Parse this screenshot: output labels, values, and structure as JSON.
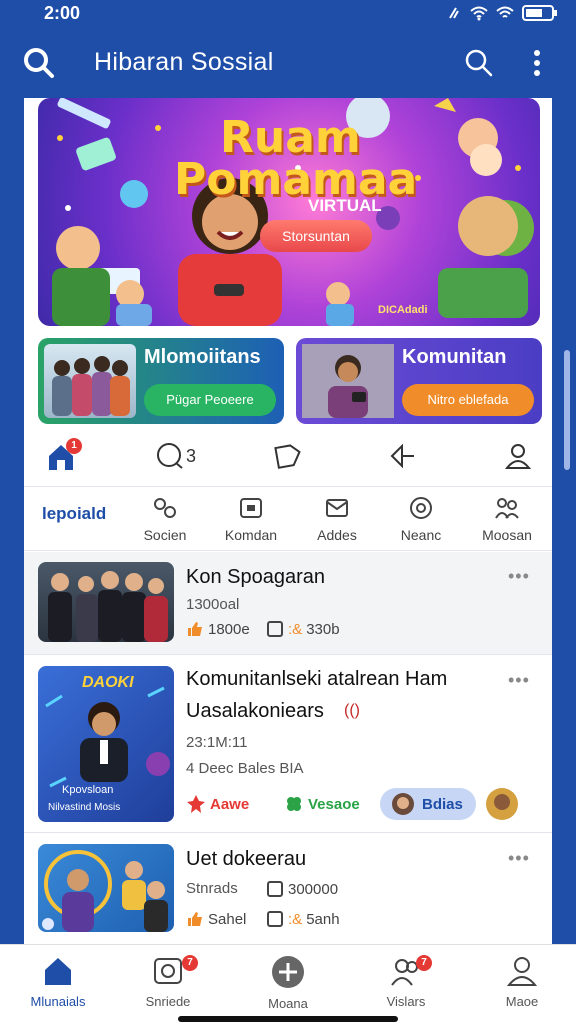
{
  "status_bar": {
    "time": "2:00"
  },
  "app_bar": {
    "title": "Hibaran Sossial"
  },
  "banner": {
    "title_line1": "Ruam",
    "title_line2": "Pomamaa",
    "subtitle": "VIRTUAL",
    "pill_label": "Storsuntan",
    "corner_text": "DICAdadi",
    "colors": {
      "title": "#ffd23a",
      "pill": "#e8484a"
    }
  },
  "community_cards": [
    {
      "title": "Mlomoiitans",
      "button": "Pügar Peoeere",
      "color": "#28b463"
    },
    {
      "title": "Komunitan",
      "button": "Nitro eblefada",
      "color": "#f08d2a"
    }
  ],
  "quick_actions": {
    "home_badge": "1",
    "comment_count": "3"
  },
  "categories": {
    "first": "lepoiald",
    "items": [
      {
        "label": "Socien",
        "icon": "share-icon"
      },
      {
        "label": "Komdan",
        "icon": "chat-box-icon"
      },
      {
        "label": "Addes",
        "icon": "mail-icon"
      },
      {
        "label": "Neanc",
        "icon": "at-icon"
      },
      {
        "label": "Moosan",
        "icon": "people-icon"
      }
    ]
  },
  "feed": [
    {
      "title": "Kon Spoagaran",
      "meta": "1300oal",
      "likes": "1800e",
      "comments": "330b"
    },
    {
      "title": "Komunitanlseki atalrean Ham",
      "title2": "Uasalakoniears",
      "thumb_title": "DAOKI",
      "thumb_caption1": "Kpovsloan",
      "thumb_caption2": "Nilvastind Mosis",
      "time": "23:1M:11",
      "sub": "4 Deec Bales BIA",
      "chips": [
        "Aawe",
        "Vesaoe",
        "Bdias"
      ]
    },
    {
      "title": "Uet dokeerau",
      "meta": "Stnrads",
      "views": "300000",
      "likes": "Sahel",
      "comments": "5anh"
    }
  ],
  "bottom_nav": [
    {
      "label": "Mlunaials",
      "icon": "home-icon",
      "active": true
    },
    {
      "label": "Snriede",
      "icon": "gallery-icon",
      "badge": "7"
    },
    {
      "label": "Moana",
      "icon": "plus-icon"
    },
    {
      "label": "Vislars",
      "icon": "people-icon",
      "badge": "7"
    },
    {
      "label": "Maoe",
      "icon": "profile-icon"
    }
  ]
}
